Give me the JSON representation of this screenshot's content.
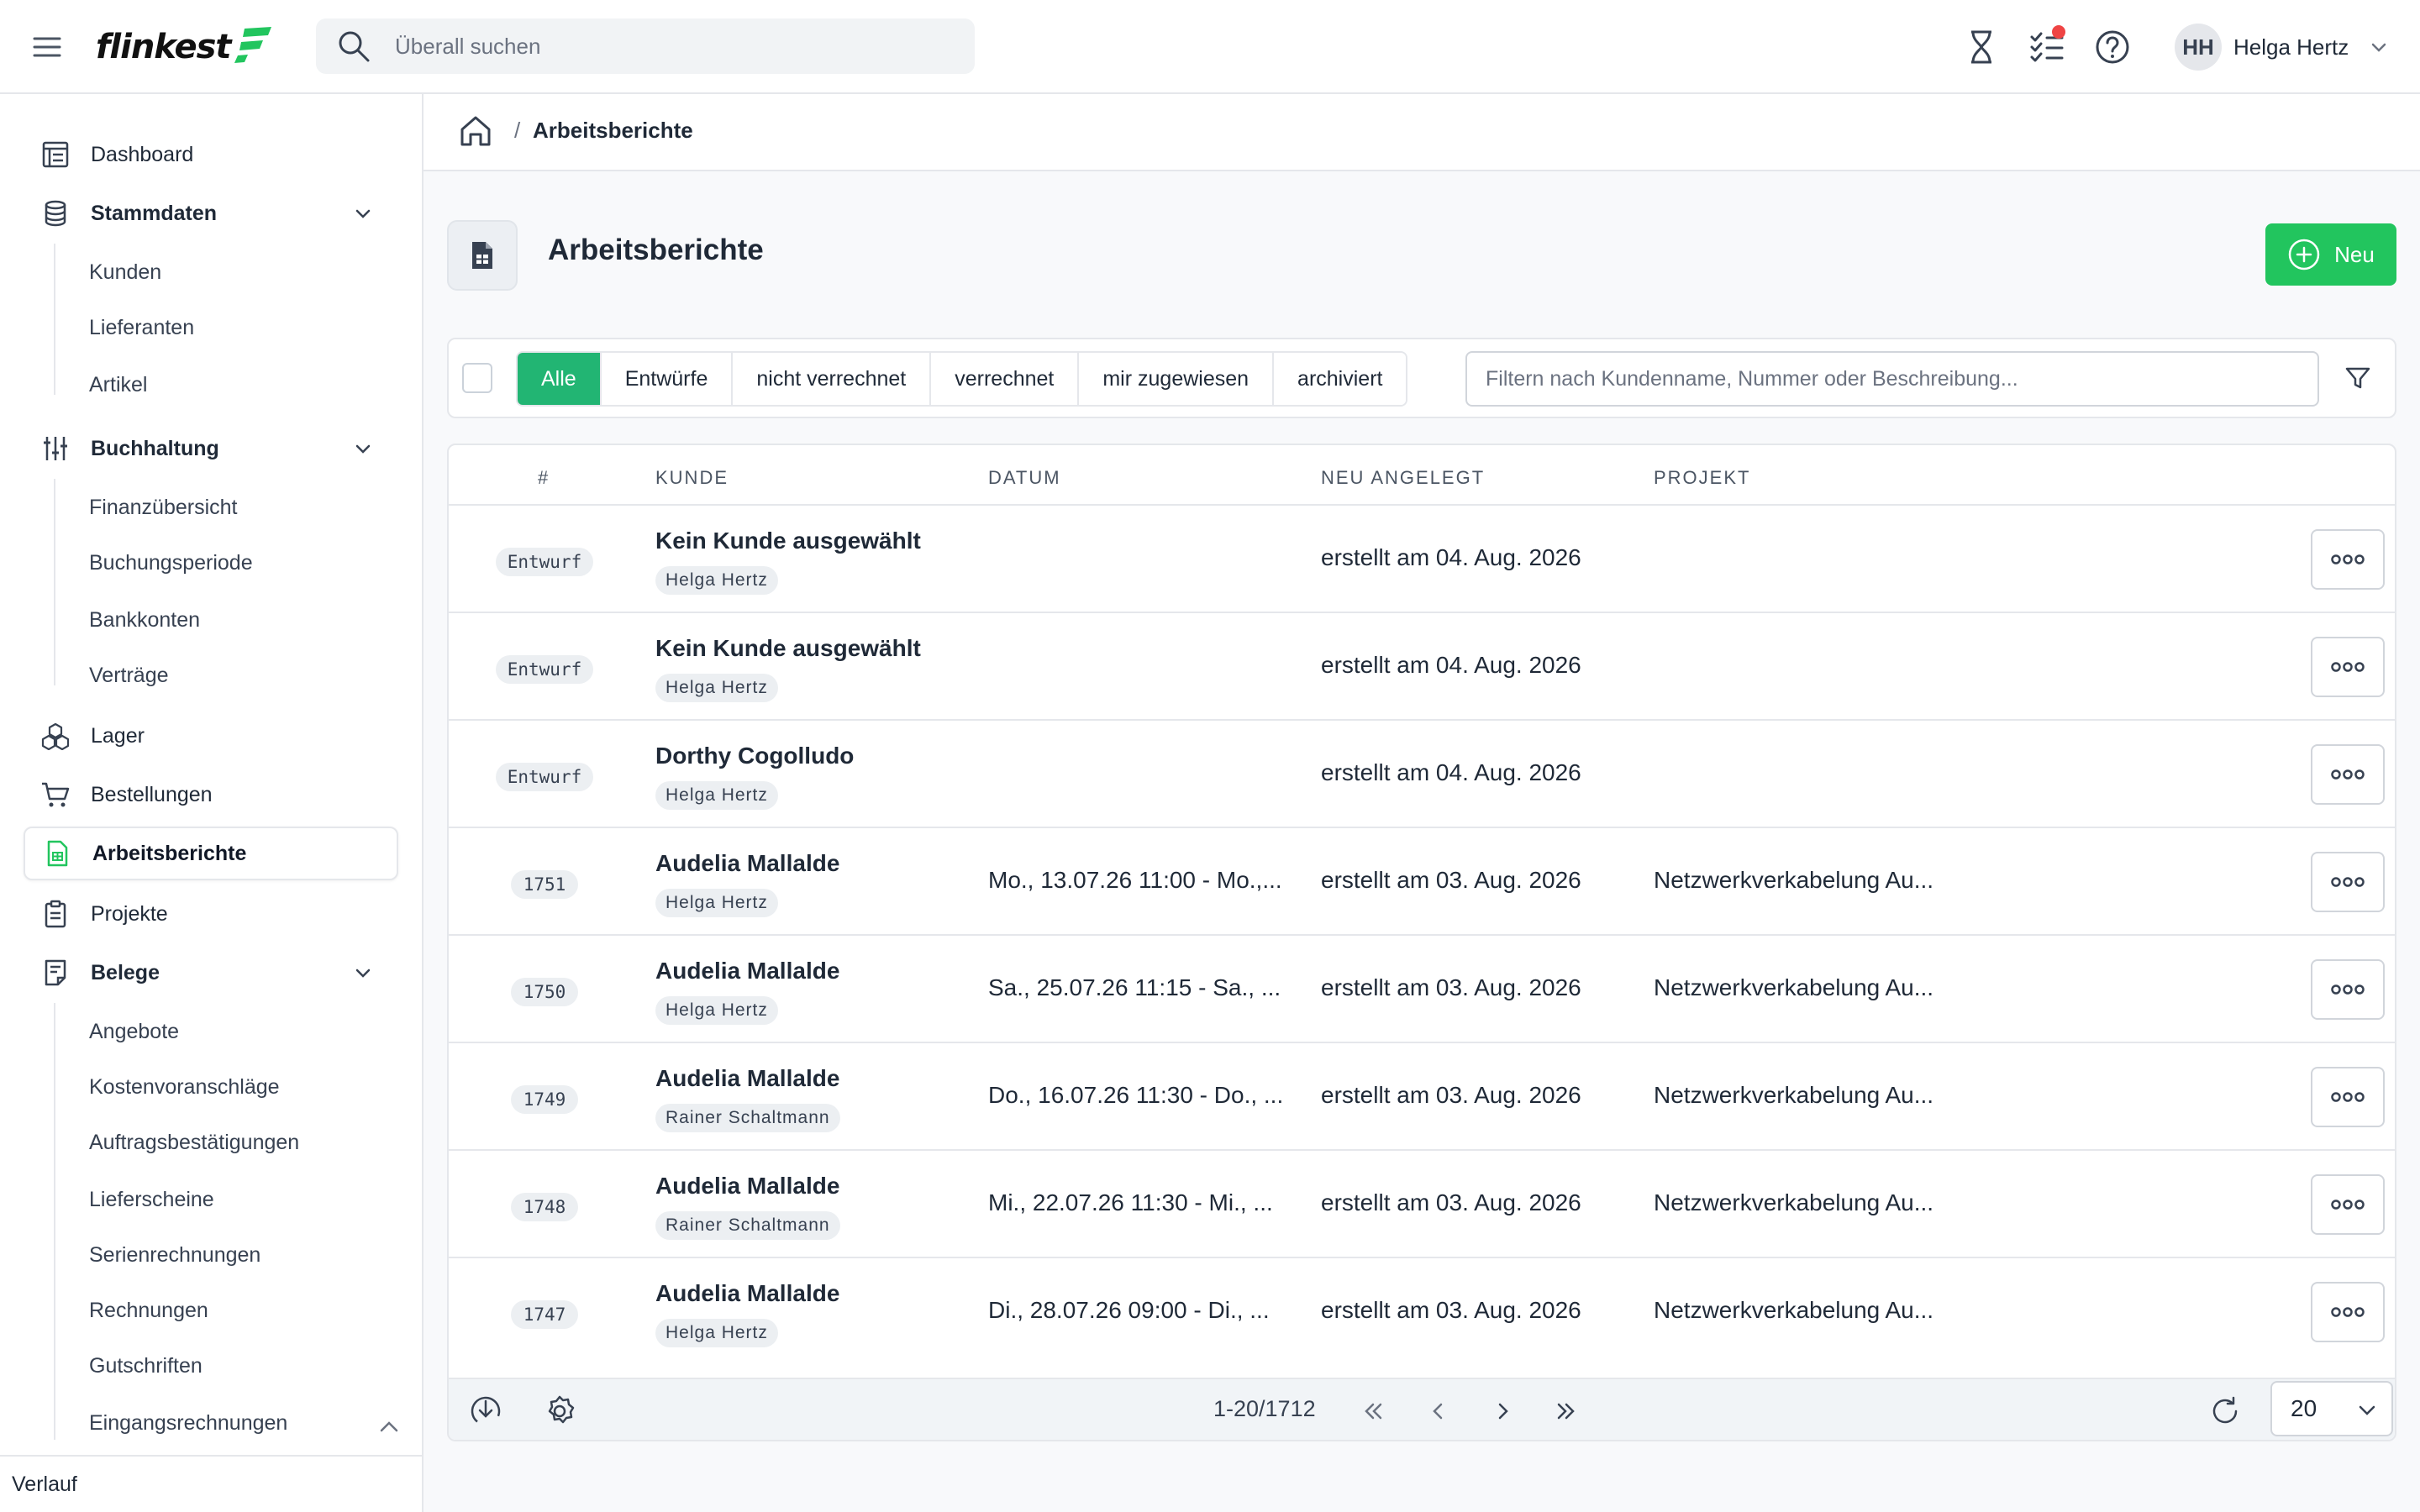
{
  "header": {
    "logo_text": "flinkest",
    "search_placeholder": "Überall suchen",
    "user_initials": "HH",
    "user_name": "Helga Hertz"
  },
  "sidebar": {
    "items": [
      {
        "label": "Dashboard",
        "icon": "dashboard-icon"
      },
      {
        "label": "Stammdaten",
        "icon": "database-icon",
        "expanded": true,
        "children": [
          "Kunden",
          "Lieferanten",
          "Artikel"
        ]
      },
      {
        "label": "Buchhaltung",
        "icon": "sliders-icon",
        "expanded": true,
        "children": [
          "Finanzübersicht",
          "Buchungsperiode",
          "Bankkonten",
          "Verträge"
        ]
      },
      {
        "label": "Lager",
        "icon": "boxes-icon"
      },
      {
        "label": "Bestellungen",
        "icon": "cart-icon"
      },
      {
        "label": "Arbeitsberichte",
        "icon": "report-icon",
        "active": true
      },
      {
        "label": "Projekte",
        "icon": "clipboard-icon"
      },
      {
        "label": "Belege",
        "icon": "receipt-icon",
        "expanded": true,
        "children": [
          "Angebote",
          "Kostenvoranschläge",
          "Auftragsbestätigungen",
          "Lieferscheine",
          "Serienrechnungen",
          "Rechnungen",
          "Gutschriften",
          "Eingangsrechnungen"
        ]
      }
    ],
    "footer_label": "Verlauf"
  },
  "breadcrumb": {
    "separator": "/",
    "current": "Arbeitsberichte"
  },
  "page": {
    "title": "Arbeitsberichte",
    "new_button": "Neu"
  },
  "filters": {
    "tabs": [
      "Alle",
      "Entwürfe",
      "nicht verrechnet",
      "verrechnet",
      "mir zugewiesen",
      "archiviert"
    ],
    "active_tab": "Alle",
    "search_placeholder": "Filtern nach Kundenname, Nummer oder Beschreibung..."
  },
  "table": {
    "columns": [
      "#",
      "KUNDE",
      "DATUM",
      "NEU ANGELEGT",
      "PROJEKT"
    ],
    "rows": [
      {
        "id": "Entwurf",
        "customer": "Kein Kunde ausgewählt",
        "assignee": "Helga Hertz",
        "date": "",
        "created": "erstellt am 04. Aug. 2026",
        "project": ""
      },
      {
        "id": "Entwurf",
        "customer": "Kein Kunde ausgewählt",
        "assignee": "Helga Hertz",
        "date": "",
        "created": "erstellt am 04. Aug. 2026",
        "project": ""
      },
      {
        "id": "Entwurf",
        "customer": "Dorthy Cogolludo",
        "assignee": "Helga Hertz",
        "date": "",
        "created": "erstellt am 04. Aug. 2026",
        "project": ""
      },
      {
        "id": "1751",
        "customer": "Audelia Mallalde",
        "assignee": "Helga Hertz",
        "date": "Mo., 13.07.26 11:00 - Mo.,...",
        "created": "erstellt am 03. Aug. 2026",
        "project": "Netzwerkverkabelung Au..."
      },
      {
        "id": "1750",
        "customer": "Audelia Mallalde",
        "assignee": "Helga Hertz",
        "date": "Sa., 25.07.26 11:15 - Sa., ...",
        "created": "erstellt am 03. Aug. 2026",
        "project": "Netzwerkverkabelung Au..."
      },
      {
        "id": "1749",
        "customer": "Audelia Mallalde",
        "assignee": "Rainer Schaltmann",
        "date": "Do., 16.07.26 11:30 - Do., ...",
        "created": "erstellt am 03. Aug. 2026",
        "project": "Netzwerkverkabelung Au..."
      },
      {
        "id": "1748",
        "customer": "Audelia Mallalde",
        "assignee": "Rainer Schaltmann",
        "date": "Mi., 22.07.26 11:30 - Mi., ...",
        "created": "erstellt am 03. Aug. 2026",
        "project": "Netzwerkverkabelung Au..."
      },
      {
        "id": "1747",
        "customer": "Audelia Mallalde",
        "assignee": "Helga Hertz",
        "date": "Di., 28.07.26 09:00 - Di., ...",
        "created": "erstellt am 03. Aug. 2026",
        "project": "Netzwerkverkabelung Au..."
      }
    ]
  },
  "pagination": {
    "range": "1-20/1712",
    "page_size": "20"
  },
  "colors": {
    "accent": "#22c55e",
    "active_tab": "#22b573",
    "notification": "#ef4444"
  }
}
